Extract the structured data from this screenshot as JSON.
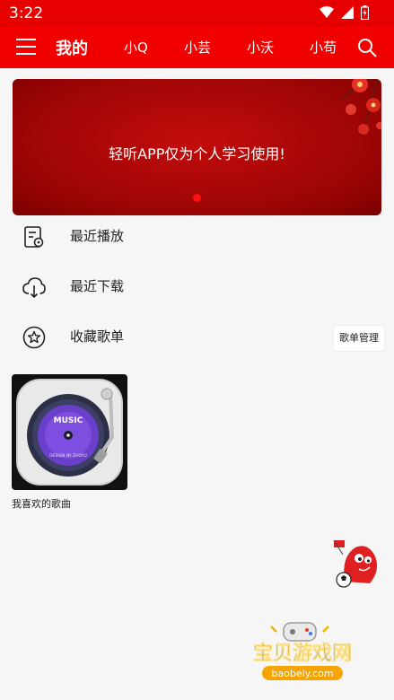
{
  "status_bar": {
    "time": "3:22"
  },
  "app_bar": {
    "tabs": [
      {
        "label": "我的",
        "active": true
      },
      {
        "label": "小Q",
        "active": false
      },
      {
        "label": "小芸",
        "active": false
      },
      {
        "label": "小沃",
        "active": false
      },
      {
        "label": "小苟",
        "active": false
      }
    ]
  },
  "banner": {
    "text": "轻听APP仅为个人学习使用!"
  },
  "menu": {
    "items": [
      {
        "label": "最近播放",
        "icon": "recent-play-icon"
      },
      {
        "label": "最近下载",
        "icon": "cloud-download-icon"
      },
      {
        "label": "收藏歌单",
        "icon": "star-icon"
      }
    ],
    "manage_label": "歌单管理"
  },
  "playlists": [
    {
      "name": "我喜欢的歌曲",
      "cover_text": "MUSIC",
      "cover_subtext": "DESIGN BY ZHOYU"
    }
  ],
  "watermark": {
    "title": "宝贝游戏网",
    "url": "baobeiy.com"
  },
  "colors": {
    "accent": "#f10000",
    "status_bar": "#e60000",
    "banner": "#a80606"
  }
}
